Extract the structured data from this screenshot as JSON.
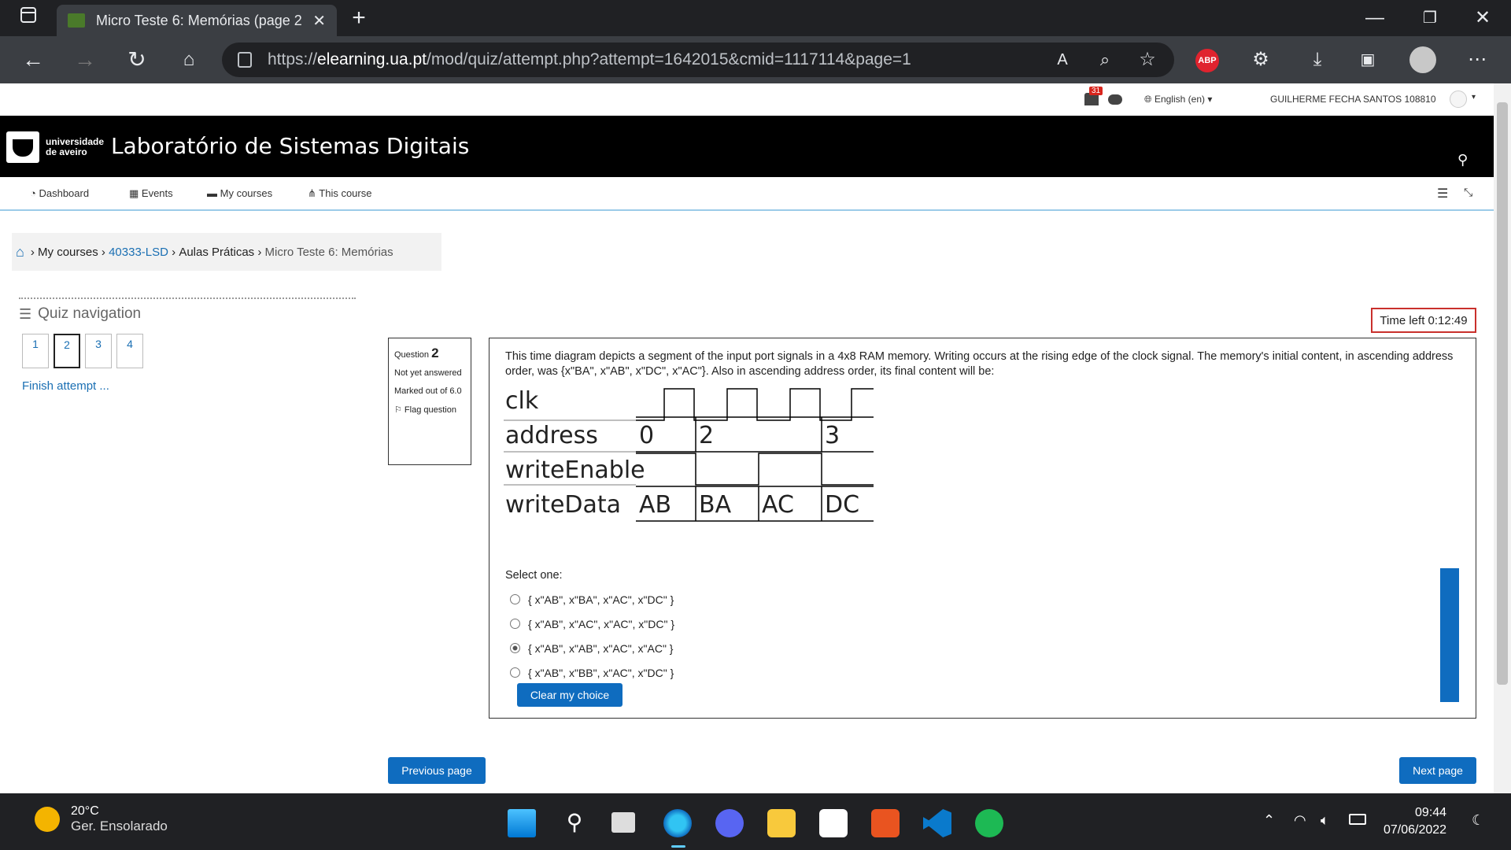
{
  "browser": {
    "tab_title": "Micro Teste 6: Memórias (page 2",
    "url_prefix": "https://",
    "url_host": "elearning.ua.pt",
    "url_path": "/mod/quiz/attempt.php?attempt=1642015&cmid=1117114&page=1",
    "abp_label": "ABP"
  },
  "userbar": {
    "notifications": "31",
    "language": "English (en)",
    "user": "GUILHERME FECHA SANTOS 108810"
  },
  "header": {
    "logo_line1": "universidade",
    "logo_line2": "de aveiro",
    "title": "Laboratório de Sistemas Digitais"
  },
  "nav": [
    "Dashboard",
    "Events",
    "My courses",
    "This course"
  ],
  "breadcrumb": [
    "My courses",
    "40333-LSD",
    "Aulas Práticas",
    "Micro Teste 6: Memórias"
  ],
  "quiz_nav": {
    "title": "Quiz navigation",
    "questions": [
      "1",
      "2",
      "3",
      "4"
    ],
    "current": "2",
    "finish": "Finish attempt ..."
  },
  "question_info": {
    "label": "Question",
    "number": "2",
    "status": "Not yet answered",
    "marked": "Marked out of 6.0",
    "flag": "Flag question"
  },
  "timer": "Time left 0:12:49",
  "question": {
    "text": "This time diagram depicts a segment of the input port signals in a 4x8 RAM memory. Writing occurs at the rising edge of the clock signal. The memory's initial content, in ascending address order, was {x\"BA\", x\"AB\", x\"DC\", x\"AC\"}. Also in ascending address order, its final content will be:",
    "diagram": {
      "signals": [
        "clk",
        "address",
        "writeEnable",
        "writeData"
      ],
      "address_values": [
        "0",
        "2",
        "",
        "3"
      ],
      "writedata_values": [
        "AB",
        "BA",
        "AC",
        "DC"
      ]
    },
    "select_label": "Select one:",
    "options": [
      "{ x\"AB\", x\"BA\", x\"AC\", x\"DC\" }",
      "{ x\"AB\", x\"AC\", x\"AC\", x\"DC\" }",
      "{ x\"AB\", x\"AB\", x\"AC\", x\"AC\" }",
      "{ x\"AB\", x\"BB\", x\"AC\", x\"DC\" }"
    ],
    "selected_index": 2,
    "clear": "Clear my choice"
  },
  "buttons": {
    "prev": "Previous page",
    "next": "Next page"
  },
  "taskbar": {
    "temp": "20°C",
    "weather": "Ger. Ensolarado",
    "time": "09:44",
    "date": "07/06/2022"
  }
}
